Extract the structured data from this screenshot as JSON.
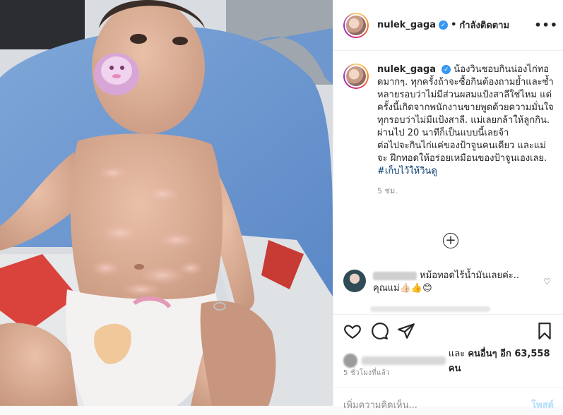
{
  "header": {
    "username": "nulek_gaga",
    "verified_mark": "✓",
    "separator": "•",
    "follow_status": "กำลังติดตาม",
    "more_icon": "more-horizontal-icon"
  },
  "caption": {
    "username": "nulek_gaga",
    "text": "น้องวินชอบกินน่องไก่ทอดมากๆ. ทุกครั้งถ้าจะซื้อกินต้องถามย้ำและซ้ำหลายรอบว่าไม่มีส่วนผสมแป้งสาลีใช่ไหม แต่ครั้งนี้เกิดจากพนักงานขายพูดด้วยความมั่นใจทุกรอบว่าไม่มีแป้งสาลี. แม่เลยกล้าให้ลูกกิน. ผ่านไป 20 นาทีก็เป็นแบบนี้เลยจ้า\nต่อไปจะกินไก่แค่ของป้าจูนคนเดียว และแม่จะ ฝึกทอดให้อร่อยเหมือนของป้าจูนเองเลย. ",
    "hashtag": "#เก็บไว้ให้วินดู",
    "time": "5 ชม."
  },
  "load_more_icon": "plus-circle-icon",
  "comment": {
    "text": " หม้อทอดไร้น้ำมันเลยค่ะ.. คุณแม่👍🏻👍😊"
  },
  "actions": {
    "like_icon": "heart-icon",
    "comment_icon": "comment-icon",
    "share_icon": "send-icon",
    "save_icon": "bookmark-icon"
  },
  "likes": {
    "prefix": "และ ",
    "others_label": "คนอื่นๆ อีก 63,558 คน"
  },
  "timestamp": "5 ชั่วโมงที่แล้ว",
  "add_comment": {
    "placeholder": "เพิ่มความคิดเห็น...",
    "post_label": "โพสต์"
  },
  "colors": {
    "link": "#00376b",
    "verified": "#3897f0",
    "post_disabled": "#b2dffc",
    "muted": "#8e8e8e"
  }
}
